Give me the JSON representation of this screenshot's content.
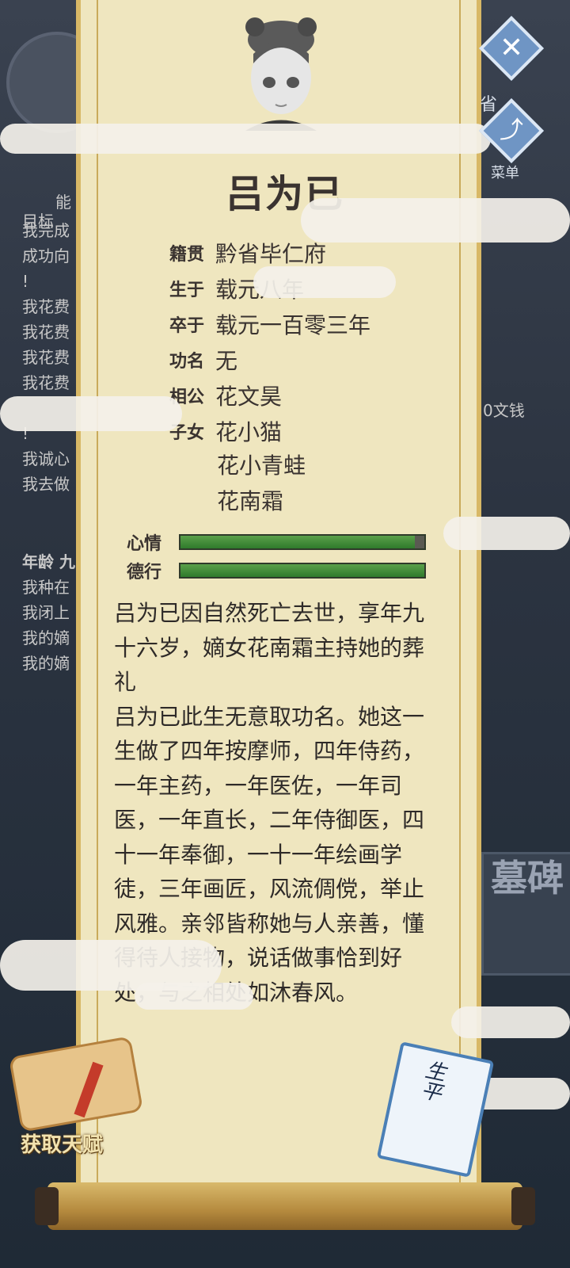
{
  "background": {
    "log_lines": [
      "我完成",
      "成功向",
      "!",
      "我花费",
      "我花费",
      "我花费",
      "我花费",
      "!",
      "我诚心",
      "我去做"
    ],
    "age_label": "年龄 九",
    "log_lines_2": [
      "我种在",
      "我闭上",
      "我的嫡",
      "我的嫡"
    ],
    "right_text": "0文钱",
    "tomb_label": "墓碑",
    "target_label": "目标",
    "ability_label": "能"
  },
  "top_buttons": {
    "close_glyph": "✕",
    "share_glyph": "⤴",
    "province_label": "省",
    "menu_label": "菜单"
  },
  "character": {
    "name": "吕为已",
    "info": [
      {
        "label": "籍贯",
        "value": "黔省毕仁府"
      },
      {
        "label": "生于",
        "value": "载元八年"
      },
      {
        "label": "卒于",
        "value": "载元一百零三年"
      },
      {
        "label": "功名",
        "value": "无"
      },
      {
        "label": "相公",
        "value": "花文昊"
      },
      {
        "label": "子女",
        "value": "花小猫"
      }
    ],
    "children_more": [
      "花小青蛙",
      "花南霜"
    ],
    "stats": [
      {
        "label": "心情",
        "fill": 0.96
      },
      {
        "label": "德行",
        "fill": 1.0
      }
    ],
    "bio": [
      "吕为已因自然死亡去世，享年九十六岁，嫡女花南霜主持她的葬礼",
      "吕为已此生无意取功名。她这一生做了四年按摩师，四年侍药，一年主药，一年医佐，一年司医，一年直长，二年侍御医，四十一年奉御，一十一年绘画学徒，三年画匠，风流倜傥，举止风雅。亲邻皆称她与人亲善，懂得待人接物，说话做事恰到好处，与之相处如沐春风。"
    ]
  },
  "bottom": {
    "talent_button_label": "获取天赋",
    "book_title": "生平"
  }
}
